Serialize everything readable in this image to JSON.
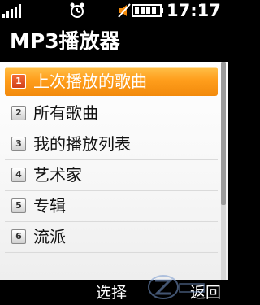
{
  "status_bar": {
    "time": "17:17",
    "icons": [
      "signal-strength-icon",
      "alarm-clock-icon",
      "silent-mode-icon",
      "battery-icon"
    ]
  },
  "header": {
    "title": "MP3播放器"
  },
  "menu": {
    "items": [
      {
        "number": "1",
        "label": "上次播放的歌曲",
        "selected": true
      },
      {
        "number": "2",
        "label": "所有歌曲",
        "selected": false
      },
      {
        "number": "3",
        "label": "我的播放列表",
        "selected": false
      },
      {
        "number": "4",
        "label": "艺术家",
        "selected": false
      },
      {
        "number": "5",
        "label": "专辑",
        "selected": false
      },
      {
        "number": "6",
        "label": "流派",
        "selected": false
      }
    ]
  },
  "softkeys": {
    "left": "选择",
    "right": "返回"
  },
  "colors": {
    "highlight": "#f7941d",
    "background": "#ffffff",
    "bar": "#000000"
  }
}
